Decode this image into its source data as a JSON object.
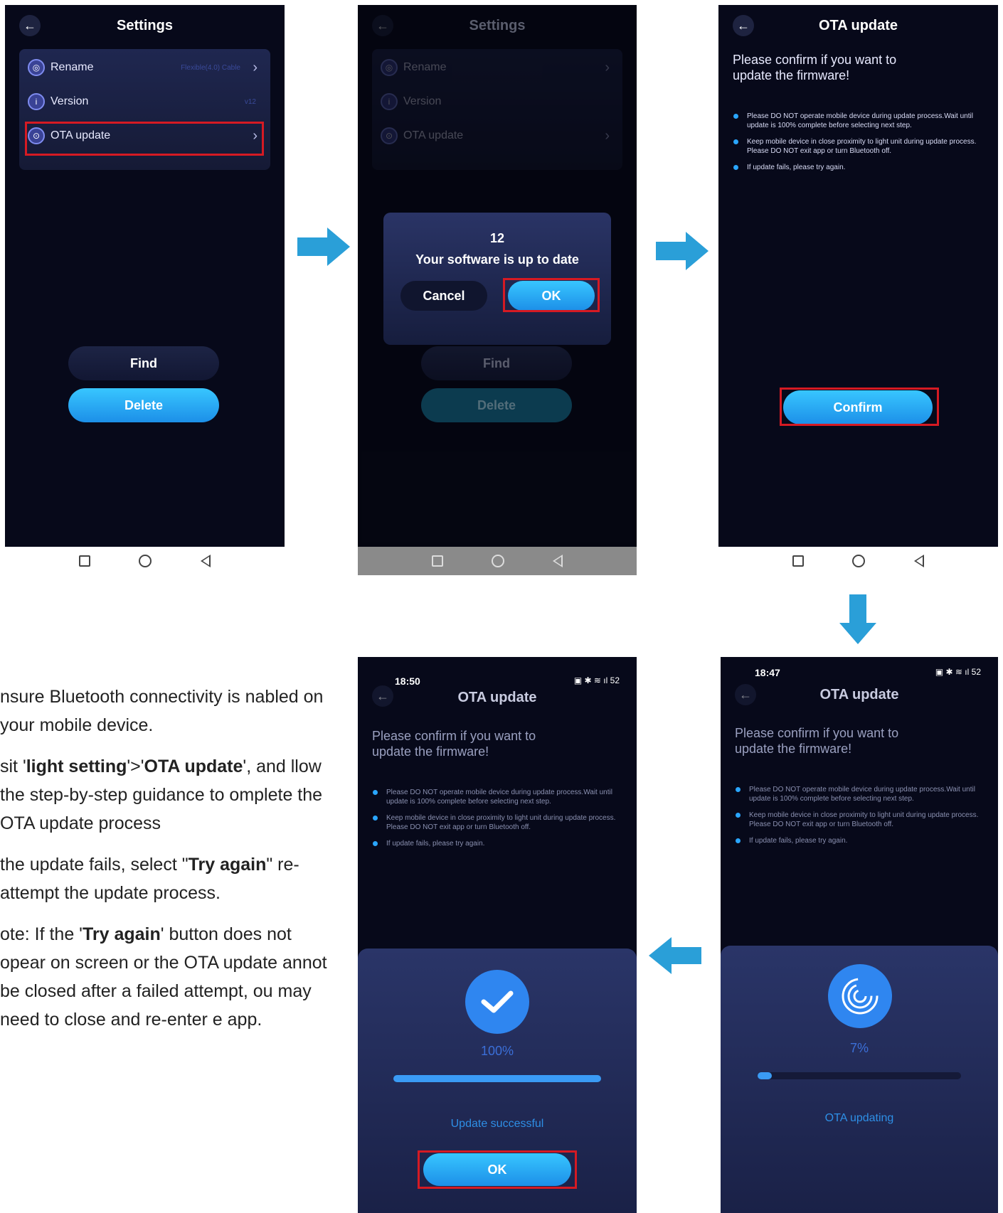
{
  "screen1": {
    "title": "Settings",
    "back_icon": "arrow-left-icon",
    "items": [
      {
        "label": "Rename",
        "value": "Flexible(4.0) Cable",
        "icon": "rename-icon"
      },
      {
        "label": "Version",
        "value": "v12",
        "icon": "info-icon"
      },
      {
        "label": "OTA update",
        "value": "",
        "icon": "ota-icon"
      }
    ],
    "find_label": "Find",
    "delete_label": "Delete"
  },
  "screen2": {
    "title": "Settings",
    "items": [
      {
        "label": "Rename"
      },
      {
        "label": "Version"
      },
      {
        "label": "OTA update"
      }
    ],
    "dialog": {
      "version": "12",
      "message": "Your software is up to date",
      "cancel_label": "Cancel",
      "ok_label": "OK"
    },
    "find_label": "Find",
    "delete_label": "Delete"
  },
  "screen3": {
    "title": "OTA update",
    "heading": "Please confirm if you want to update the firmware!",
    "bullets": [
      "Please DO NOT operate mobile device during update process.Wait until update is 100% complete before selecting next step.",
      "Keep mobile device in close proximity to light unit during update process. Please DO NOT exit app or turn Bluetooth off.",
      "If update fails, please try again."
    ],
    "confirm_label": "Confirm"
  },
  "screen4": {
    "time": "18:47",
    "status_icons": "▣ ✱ ≋ ıl 52",
    "title": "OTA update",
    "heading": "Please confirm if you want to update the firmware!",
    "bullets": [
      "Please DO NOT operate mobile device during update process.Wait until update is 100% complete before selecting next step.",
      "Keep mobile device in close proximity to light unit during update process. Please DO NOT exit app or turn Bluetooth off.",
      "If update fails, please try again."
    ],
    "progress_text": "7%",
    "progress": 0.07,
    "status": "OTA updating"
  },
  "screen5": {
    "time": "18:50",
    "status_icons": "▣ ✱ ≋ ıl 52",
    "title": "OTA update",
    "heading": "Please confirm if you want to update the firmware!",
    "bullets": [
      "Please DO NOT operate mobile device during update process.Wait until update is 100% complete before selecting next step.",
      "Keep mobile device in close proximity to light unit during update process. Please DO NOT exit app or turn Bluetooth off.",
      "If update fails, please try again."
    ],
    "progress_text": "100%",
    "progress": 1.0,
    "status": "Update successful",
    "ok_label": "OK"
  },
  "instructions": {
    "p1": "nsure Bluetooth connectivity is nabled on your mobile device.",
    "p2_a": "sit '",
    "p2_b": "light setting",
    "p2_c": "'>'",
    "p2_d": "OTA update",
    "p2_e": "', and llow the step-by-step guidance to omplete the OTA update process",
    "p3_a": "the update fails, select \"",
    "p3_b": "Try again",
    "p3_c": "\" re-attempt the update process.",
    "p4_a": "ote: If the '",
    "p4_b": "Try again",
    "p4_c": "' button does not opear on screen or the OTA update annot be closed after a failed attempt, ou may need to close and re-enter e app."
  },
  "colors": {
    "accent_blue": "#1c9be6",
    "highlight_red": "#d51a23",
    "screen_bg": "#07091a"
  }
}
